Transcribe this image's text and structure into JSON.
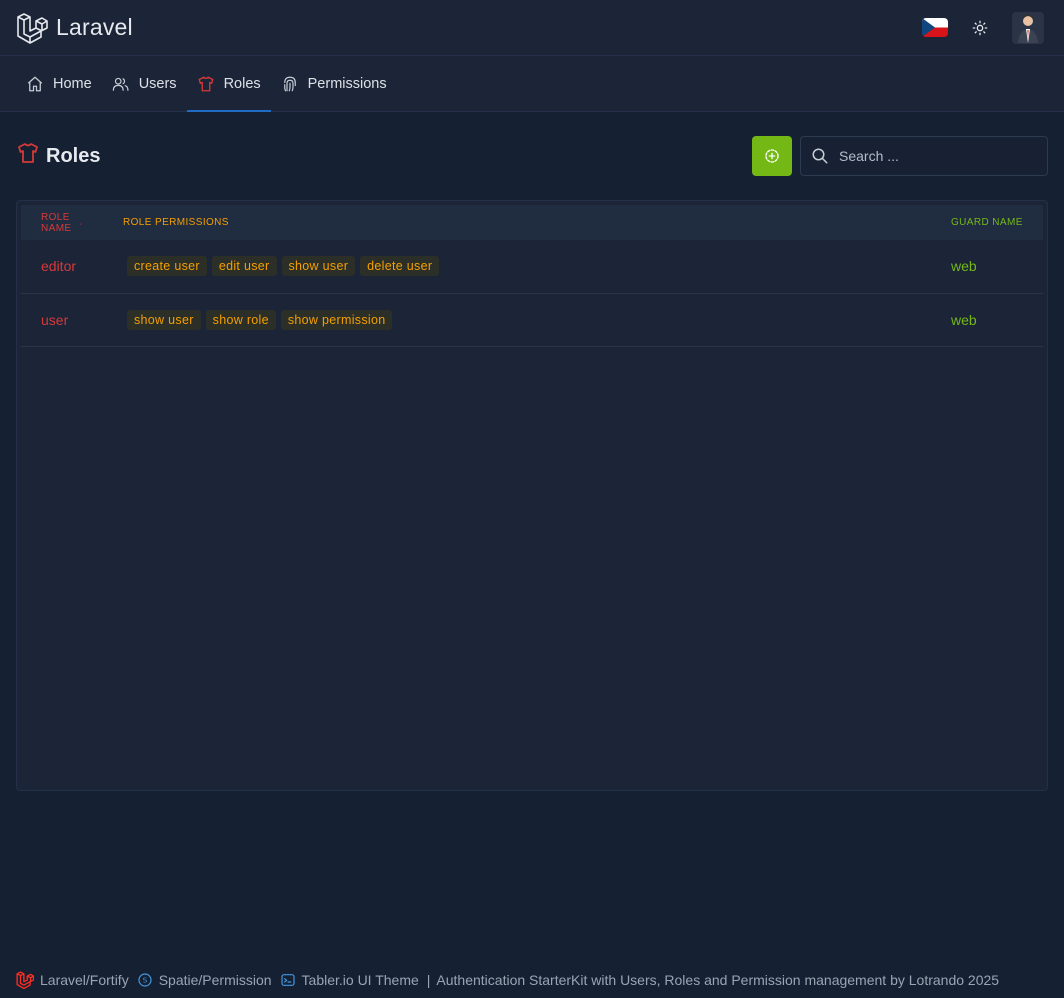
{
  "brand": {
    "name": "Laravel"
  },
  "header": {
    "flag": "cz-flag-icon",
    "theme_toggle": "sun-icon",
    "avatar": "user-avatar"
  },
  "nav": {
    "items": [
      {
        "label": "Home",
        "icon": "home-icon"
      },
      {
        "label": "Users",
        "icon": "users-icon"
      },
      {
        "label": "Roles",
        "icon": "shirt-icon",
        "active": true
      },
      {
        "label": "Permissions",
        "icon": "fingerprint-icon"
      }
    ]
  },
  "page": {
    "title": "Roles"
  },
  "search": {
    "placeholder": "Search ..."
  },
  "table": {
    "headers": {
      "name": "Role name",
      "permissions": "Role permissions",
      "guard": "Guard name"
    },
    "rows": [
      {
        "name": "editor",
        "permissions": [
          "create user",
          "edit user",
          "show user",
          "delete user"
        ],
        "guard": "web"
      },
      {
        "name": "user",
        "permissions": [
          "show user",
          "show role",
          "show permission"
        ],
        "guard": "web"
      }
    ]
  },
  "colors": {
    "name_accent": "#d63939",
    "permission_accent": "#f59f00",
    "guard_accent": "#74b816",
    "add_button": "#74b816",
    "active_tab": "#206bc4"
  },
  "footer": {
    "fortify": "Laravel/Fortify",
    "spatie": "Spatie/Permission",
    "tabler": "Tabler.io UI Theme",
    "separator": "|",
    "credit": "Authentication StarterKit with Users, Roles and Permission management by Lotrando 2025"
  }
}
